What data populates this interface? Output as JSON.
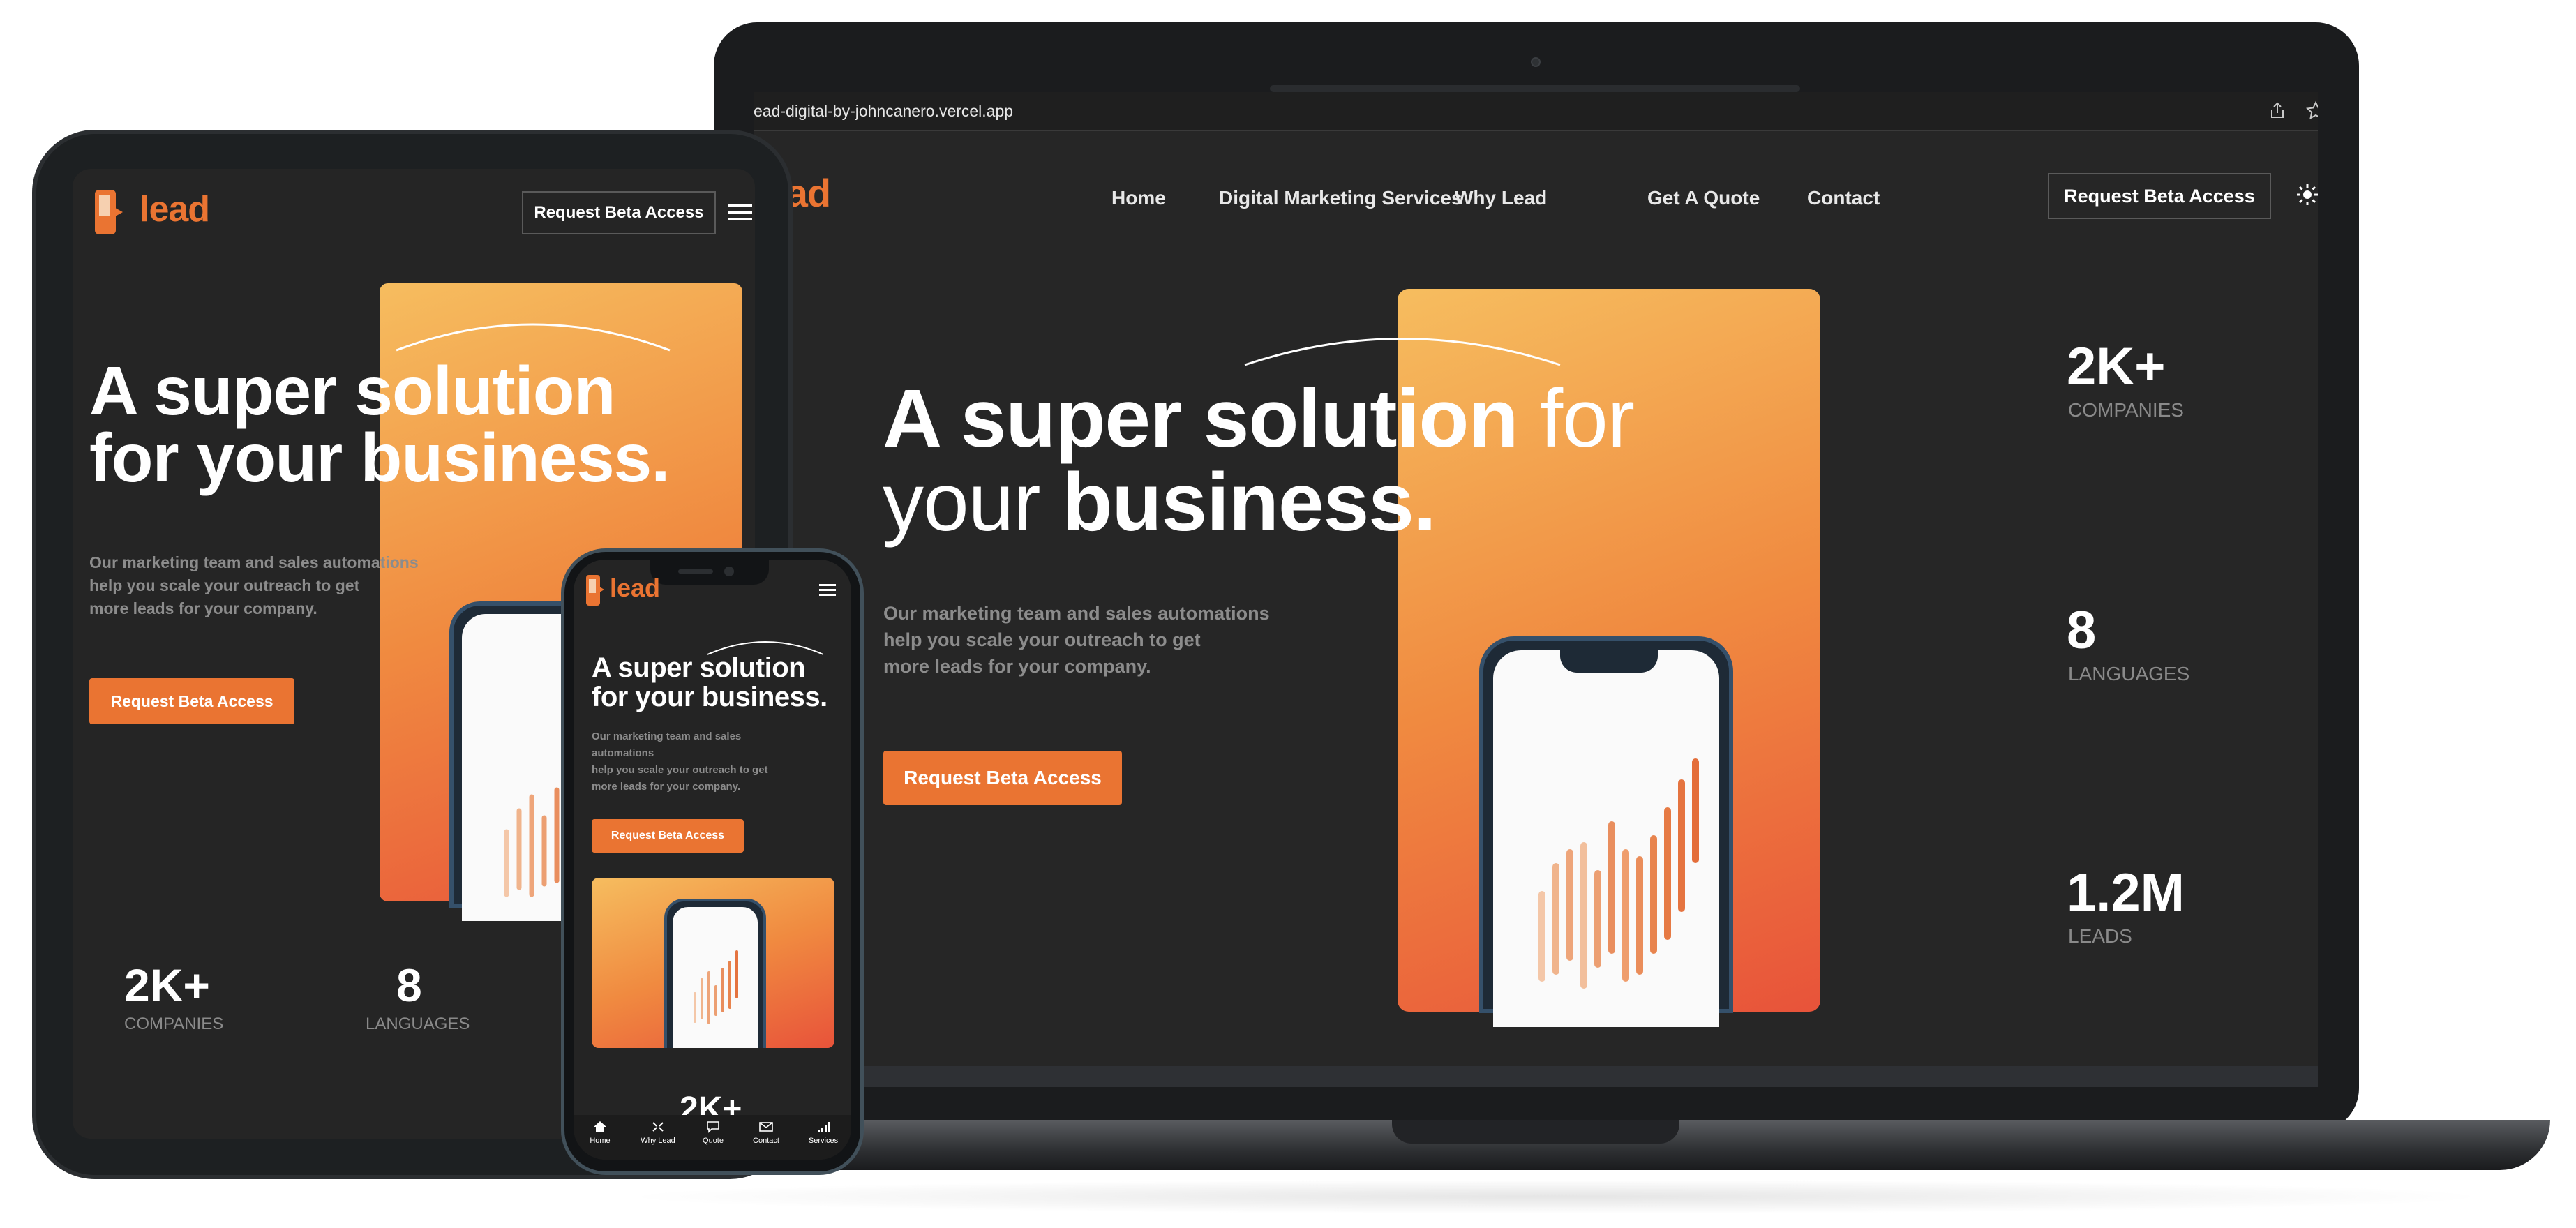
{
  "laptop": {
    "url": "ead-digital-by-johncanero.vercel.app",
    "logo_text": "lead",
    "nav": [
      {
        "label": "Home"
      },
      {
        "label": "Digital Marketing Services"
      },
      {
        "label": "Why Lead"
      },
      {
        "label": "Get A Quote"
      },
      {
        "label": "Contact"
      }
    ],
    "cta_outline": "Request Beta Access",
    "hero": {
      "line1_a": "A super solution",
      "line1_b": " for",
      "line2_a": "your ",
      "line2_b": "business.",
      "sub1": "Our marketing team and sales automations",
      "sub2": "help you scale your outreach to get",
      "sub3": "more leads for your company.",
      "cta": "Request Beta Access"
    },
    "stats": [
      {
        "value": "2K+",
        "label": "COMPANIES"
      },
      {
        "value": "8",
        "label": "LANGUAGES"
      },
      {
        "value": "1.2M",
        "label": "LEADS"
      }
    ]
  },
  "tablet": {
    "logo_text": "lead",
    "cta_outline": "Request Beta Access",
    "hero": {
      "line1_a": "A super ",
      "line1_b": "solution",
      "line2_a": "for your ",
      "line2_b": "business.",
      "sub1": "Our marketing team and sales automations",
      "sub2": "help you scale your outreach to get",
      "sub3": "more leads for your company.",
      "cta": "Request Beta Access"
    },
    "stats": [
      {
        "value": "2K+",
        "label": "COMPANIES"
      },
      {
        "value": "8",
        "label": "LANGUAGES"
      }
    ]
  },
  "phone": {
    "logo_text": "lead",
    "hero": {
      "line1_a": "A super ",
      "line1_b": "solution",
      "line2_a": "for your ",
      "line2_b": "business.",
      "sub1": "Our marketing team and sales",
      "sub2": "automations",
      "sub3": "help you scale your outreach to get",
      "sub4": "more leads for your company.",
      "cta": "Request Beta Access"
    },
    "stat_partial": "2K+",
    "bottom_nav": [
      {
        "label": "Home",
        "icon": "home-icon"
      },
      {
        "label": "Why Lead",
        "icon": "expand-icon"
      },
      {
        "label": "Quote",
        "icon": "quote-icon"
      },
      {
        "label": "Contact",
        "icon": "mail-icon"
      },
      {
        "label": "Services",
        "icon": "signal-icon"
      }
    ]
  },
  "colors": {
    "accent": "#ea7432",
    "background": "#262626",
    "gradient_top": "#f6bd5f",
    "gradient_bottom": "#e8533a"
  }
}
